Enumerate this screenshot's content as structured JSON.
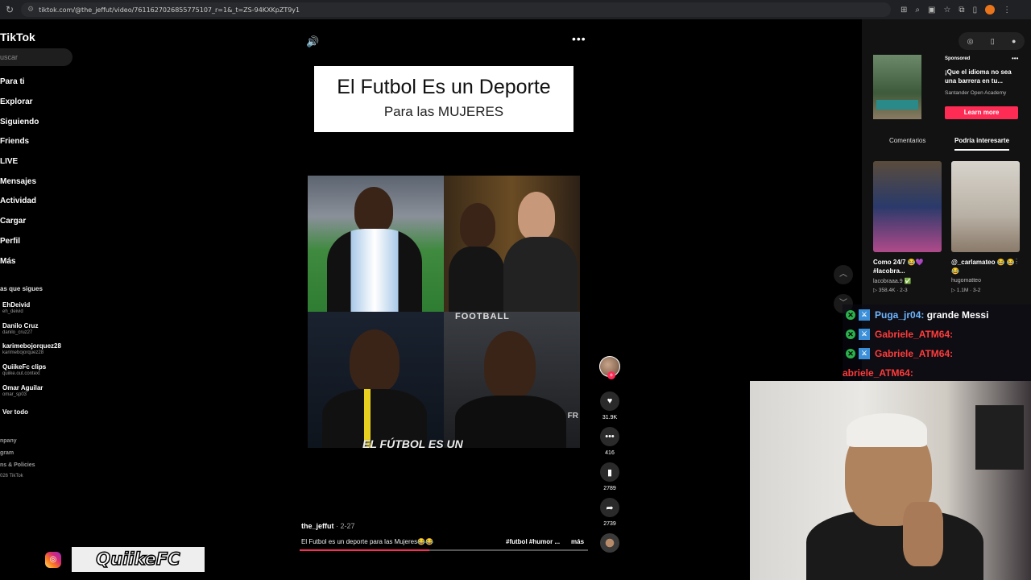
{
  "browser": {
    "url": "tiktok.com/@the_jeffut/video/7611627026855775107_r=1&_t=ZS-94KXKpZT9y1"
  },
  "sidebar": {
    "logo": "TikTok",
    "search_placeholder": "uscar",
    "nav": [
      "Para ti",
      "Explorar",
      "Siguiendo",
      "Friends",
      "LIVE",
      "Mensajes",
      "Actividad",
      "Cargar",
      "Perfil",
      "Más"
    ],
    "following_title": "as que sigues",
    "following": [
      {
        "name": "EhDeivid",
        "handle": "eh_deivid"
      },
      {
        "name": "Danilo Cruz",
        "handle": "danilo_cruz27"
      },
      {
        "name": "karimebojorquez28",
        "handle": "karimebojorquez28"
      },
      {
        "name": "QuiikeFc clips",
        "handle": "quiike.out.context"
      },
      {
        "name": "Omar Aguilar",
        "handle": "omar_sp03"
      }
    ],
    "see_all": "Ver todo",
    "footer": [
      "npany",
      "gram",
      "ns & Policies",
      "026 TikTok"
    ]
  },
  "video": {
    "title_line1": "El Futbol Es un Deporte",
    "title_line2": "Para las MUJERES",
    "overlay_text": "EL FÚTBOL ES UN",
    "football_label": "FOOTBALL",
    "fr_label": "FR",
    "likes": "31.9K",
    "comments": "416",
    "saves": "2789",
    "shares": "2739",
    "username": "the_jeffut",
    "date": "· 2-27",
    "description": "El Futbol es un deporte para las Mujeres😂😂",
    "tags": "#futbol #humor ...",
    "more": "más",
    "progress": 0.45
  },
  "right_panel": {
    "ad": {
      "sponsored": "Sponsored",
      "title": "¡Que el idioma no sea una barrera en tu...",
      "advertiser": "Santander Open Academy",
      "cta": "Learn more"
    },
    "tabs": [
      "Comentarios",
      "Podría interesarte"
    ],
    "recommendations": [
      {
        "title": "Como 24/7 😂💜 #lacobra...",
        "user": "lacobraaa.9 ✅",
        "stats": "▷ 358.4K · 2-3"
      },
      {
        "title": "@_carlamateo 😂 😂😂",
        "user": "hugomatteo",
        "stats": "▷ 1.1M · 3-2"
      }
    ]
  },
  "chat": [
    {
      "user": "Puga_jr04",
      "message": "grande Messi",
      "color": "#6fb7ff"
    },
    {
      "user": "Gabriele_ATM64",
      "message": "",
      "color": "#ff3b3b"
    },
    {
      "user": "Gabriele_ATM64",
      "message": "",
      "color": "#ff3b3b"
    },
    {
      "user": "abriele_ATM64",
      "message": "",
      "color": "#ff3b3b"
    }
  ],
  "streamer": {
    "brand": "QuiikeFC"
  }
}
